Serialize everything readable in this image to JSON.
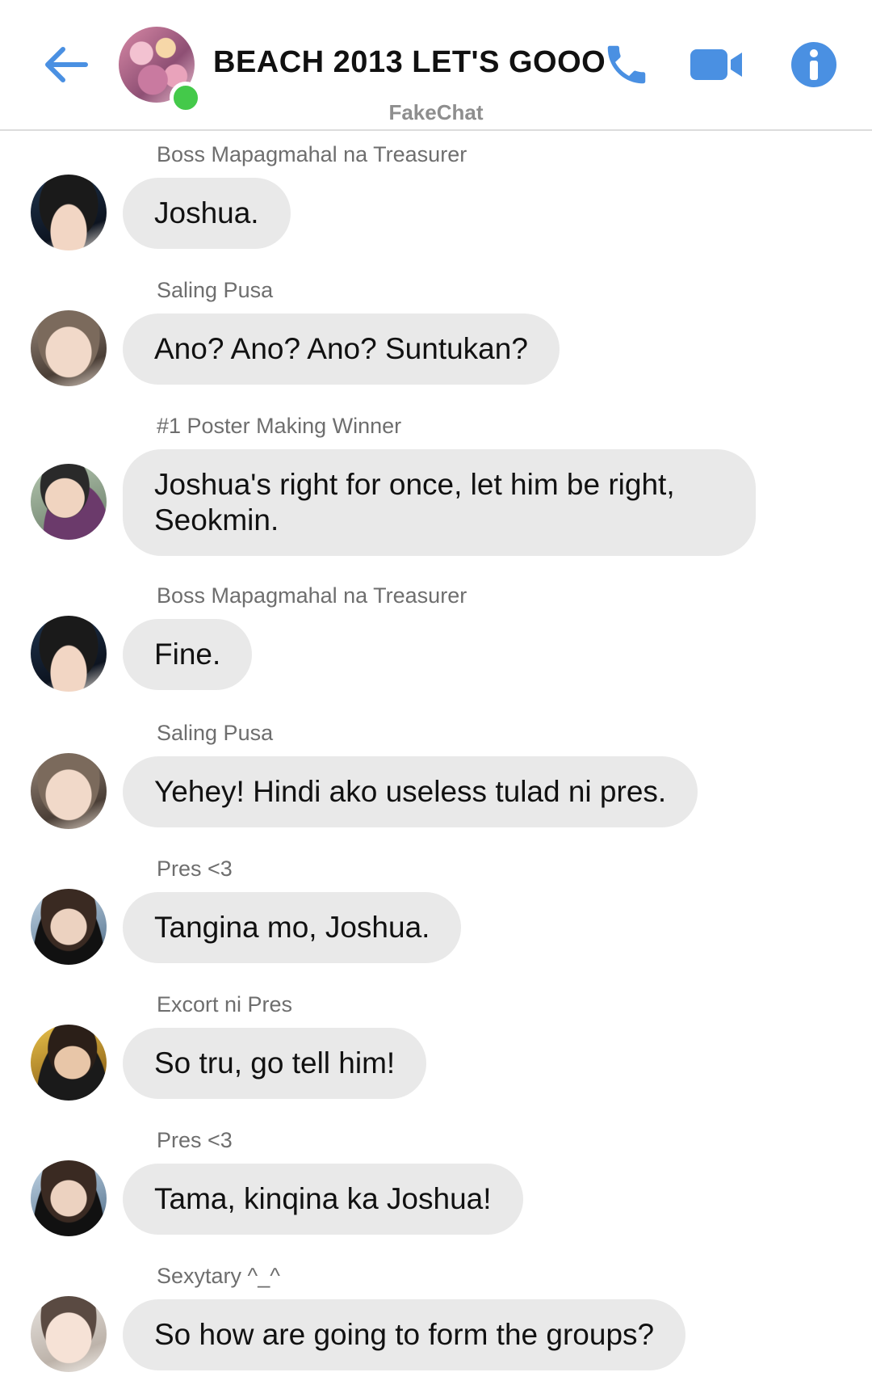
{
  "header": {
    "title": "BEACH 2013 LET'S GOOO",
    "watermark": "FakeChat",
    "accent_color": "#4a90e2",
    "icons": [
      "back-arrow-icon",
      "phone-icon",
      "video-camera-icon",
      "info-icon"
    ],
    "online_color": "#44c94a"
  },
  "messages": [
    {
      "sender": "Boss Mapagmahal na Treasurer",
      "text": "Joshua."
    },
    {
      "sender": "Saling Pusa",
      "text": "Ano? Ano? Ano? Suntukan?"
    },
    {
      "sender": "#1 Poster Making Winner",
      "text": "Joshua's right for once, let him be right, Seokmin."
    },
    {
      "sender": "Boss Mapagmahal na Treasurer",
      "text": "Fine."
    },
    {
      "sender": "Saling Pusa",
      "text": "Yehey! Hindi ako useless tulad ni pres."
    },
    {
      "sender": "Pres <3",
      "text": "Tangina mo, Joshua."
    },
    {
      "sender": "Excort ni Pres",
      "text": "So tru, go tell him!"
    },
    {
      "sender": "Pres <3",
      "text": "Tama, kinqina ka Joshua!"
    },
    {
      "sender": "Sexytary ^_^",
      "text": "So how are going to form the groups?"
    }
  ]
}
